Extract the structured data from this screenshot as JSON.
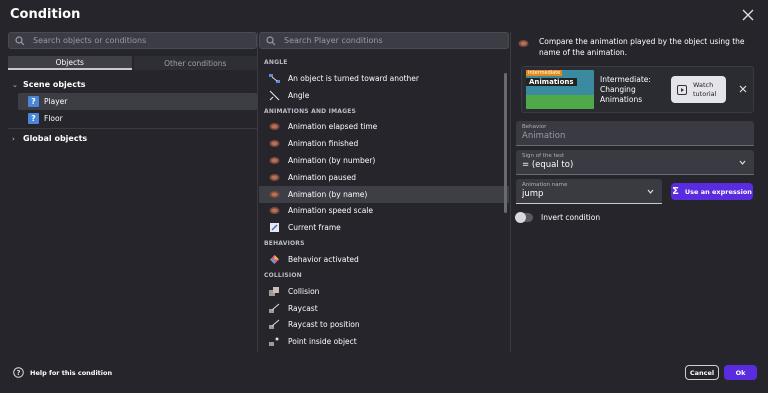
{
  "dialog": {
    "title": "Condition"
  },
  "objects_panel": {
    "search_placeholder": "Search objects or conditions",
    "tabs": [
      "Objects",
      "Other conditions"
    ],
    "groups": [
      {
        "label": "Scene objects",
        "items": [
          "Player",
          "Floor"
        ]
      },
      {
        "label": "Global objects",
        "items": []
      }
    ],
    "selected_item": "Player"
  },
  "conditions_panel": {
    "search_placeholder": "Search Player conditions",
    "sections": [
      {
        "label": "ANGLE",
        "items": [
          {
            "label": "An object is turned toward another",
            "icon": "turn-toward-icon"
          },
          {
            "label": "Angle",
            "icon": "angle-icon"
          }
        ]
      },
      {
        "label": "ANIMATIONS AND IMAGES",
        "items": [
          {
            "label": "Animation elapsed time",
            "icon": "animation-icon"
          },
          {
            "label": "Animation finished",
            "icon": "animation-icon"
          },
          {
            "label": "Animation (by number)",
            "icon": "animation-icon"
          },
          {
            "label": "Animation paused",
            "icon": "animation-icon"
          },
          {
            "label": "Animation (by name)",
            "icon": "animation-icon"
          },
          {
            "label": "Animation speed scale",
            "icon": "animation-icon"
          },
          {
            "label": "Current frame",
            "icon": "frame-icon"
          }
        ]
      },
      {
        "label": "BEHAVIORS",
        "items": [
          {
            "label": "Behavior activated",
            "icon": "behavior-icon"
          }
        ]
      },
      {
        "label": "COLLISION",
        "items": [
          {
            "label": "Collision",
            "icon": "collision-icon"
          },
          {
            "label": "Raycast",
            "icon": "raycast-icon"
          },
          {
            "label": "Raycast to position",
            "icon": "raycast-icon"
          },
          {
            "label": "Point inside object",
            "icon": "point-icon"
          }
        ]
      }
    ],
    "selected": "Animation (by name)"
  },
  "details": {
    "description": "Compare the animation played by the object using the name of the animation.",
    "tutorial": {
      "badge": "Intermediate",
      "thumb_title": "Animations",
      "title": "Intermediate: Changing Animations",
      "watch_label_1": "Watch",
      "watch_label_2": "tutorial"
    },
    "behavior": {
      "label": "Behavior",
      "value": "Animation"
    },
    "sign": {
      "label": "Sign of the test",
      "value": "= (equal to)"
    },
    "animation_name": {
      "label": "Animation name",
      "value": "jump"
    },
    "expression_button": "Use an expression",
    "invert_label": "Invert condition"
  },
  "footer": {
    "help": "Help for this condition",
    "cancel": "Cancel",
    "ok": "Ok"
  },
  "colors": {
    "accent": "#5a2ce0",
    "object_icon": "#4a86d8",
    "background": "#25252b"
  }
}
